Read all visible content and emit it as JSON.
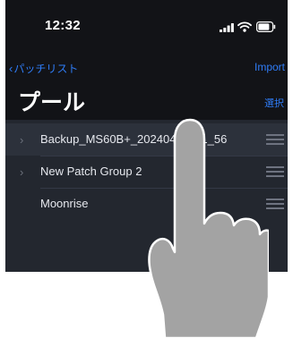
{
  "status_bar": {
    "time": "12:32",
    "icons": [
      "signal-icon",
      "wifi-icon",
      "battery-icon"
    ]
  },
  "nav": {
    "back_label": "パッチリスト",
    "import_label": "Import",
    "title": "プール",
    "select_label": "選択"
  },
  "list": {
    "items": [
      {
        "label": "Backup_MS60B+_20240417_11_56",
        "expandable": true,
        "highlighted": true
      },
      {
        "label": "New Patch Group 2",
        "expandable": true,
        "highlighted": false
      },
      {
        "label": "Moonrise",
        "expandable": false,
        "highlighted": false
      }
    ]
  },
  "colors": {
    "accent": "#2f7cf6",
    "background": "#1f2026",
    "header": "#121317",
    "row_highlight": "#2c313b",
    "gesture": "#a3a3a3"
  },
  "overlay": {
    "icon": "tap-gesture-hand-icon"
  }
}
